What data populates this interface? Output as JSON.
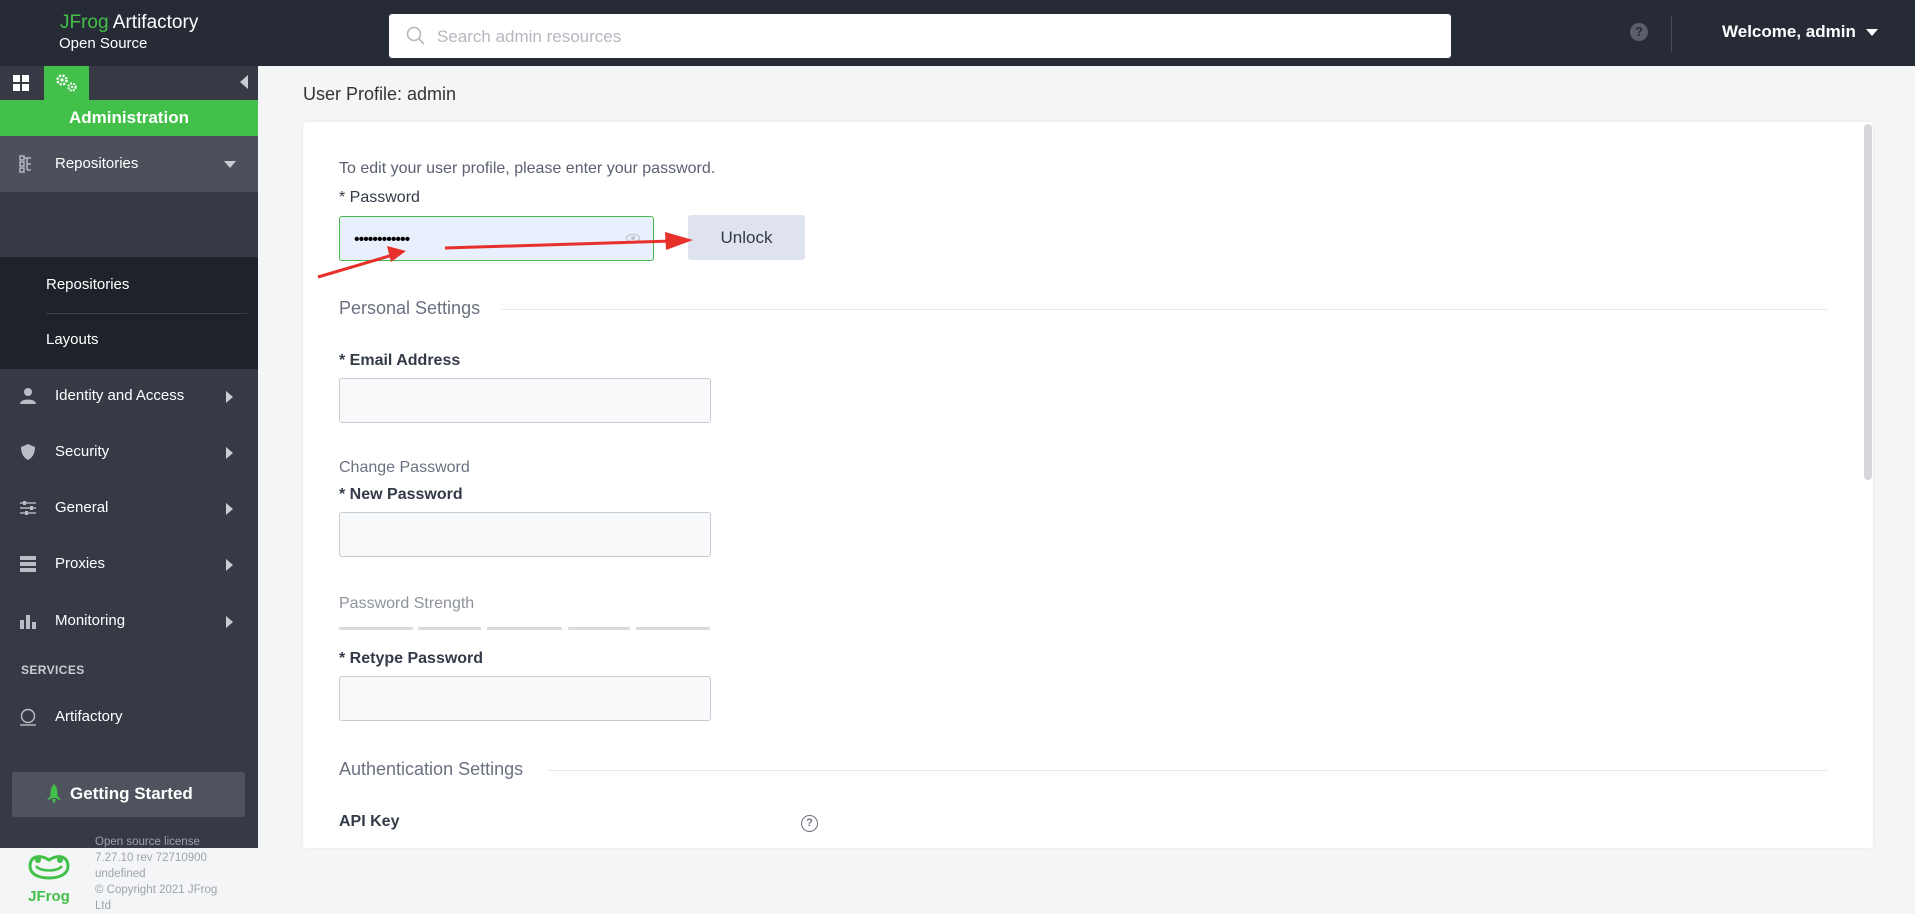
{
  "brand": {
    "jfrog": "JFrog",
    "product": " Artifactory",
    "edition": "Open Source"
  },
  "search": {
    "placeholder": "Search admin resources"
  },
  "header": {
    "welcome": "Welcome, admin",
    "help_icon": "?"
  },
  "sidebar": {
    "section_title": "Administration",
    "items": [
      {
        "label": "Repositories",
        "icon": "repositories-icon",
        "expanded": true
      },
      {
        "label": "Identity and Access",
        "icon": "user-icon"
      },
      {
        "label": "Security",
        "icon": "shield-icon"
      },
      {
        "label": "General",
        "icon": "sliders-icon"
      },
      {
        "label": "Proxies",
        "icon": "server-icon"
      },
      {
        "label": "Monitoring",
        "icon": "bar-chart-icon"
      }
    ],
    "subitems": [
      "Repositories",
      "Layouts"
    ],
    "services_heading": "SERVICES",
    "service_item": "Artifactory",
    "getting_started": "Getting Started",
    "footer": {
      "line1": "Open source license",
      "line2": "7.27.10 rev 72710900",
      "line3": "undefined",
      "line4": "© Copyright 2021 JFrog",
      "line5": "Ltd",
      "logo_text": "JFrog"
    }
  },
  "main": {
    "page_title": "User Profile: admin",
    "intro": "To edit your user profile, please enter your password.",
    "password_label": "* Password",
    "password_value": "••••••••••••",
    "unlock_label": "Unlock",
    "personal_settings": "Personal Settings",
    "email_label": "* Email Address",
    "change_password": "Change Password",
    "new_password_label": "* New Password",
    "password_strength": "Password Strength",
    "retype_password_label": "* Retype Password",
    "auth_settings": "Authentication Settings",
    "api_key_label": "API Key",
    "info_icon": "?"
  },
  "colors": {
    "accent": "#43c04a",
    "topbar": "#262b36",
    "sidebar": "#353a45",
    "annotation": "#e8302a"
  }
}
